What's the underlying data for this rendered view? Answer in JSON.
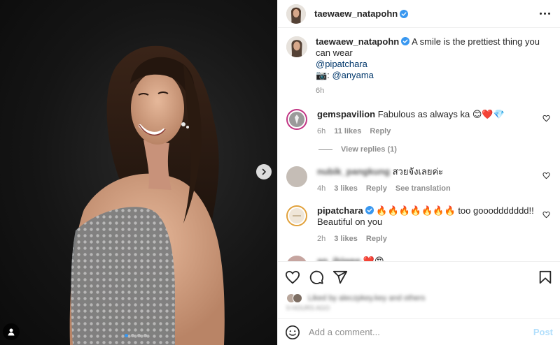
{
  "header": {
    "username": "taewaew_natapohn"
  },
  "caption": {
    "username": "taewaew_natapohn",
    "text": "A smile is the prettiest thing you can wear",
    "mention": "@pipatchara",
    "camera_glyph": "📷:",
    "camera_credit": "@anyama",
    "time": "6h"
  },
  "comments": [
    {
      "username": "gemspavilion",
      "text": "Fabulous as always ka",
      "emoji": "😊❤️💎",
      "time": "6h",
      "likes": "11 likes",
      "reply": "Reply",
      "view_replies": "View replies (1)"
    },
    {
      "username": "nubik_pangkung",
      "text": "สวยจังเลยค่ะ",
      "time": "4h",
      "likes": "3 likes",
      "reply": "Reply",
      "translate": "See translation"
    },
    {
      "username": "pipatchara",
      "fire": "🔥🔥🔥🔥🔥🔥🔥",
      "text": "too goooddddddd!! Beautiful on you",
      "time": "2h",
      "likes": "3 likes",
      "reply": "Reply"
    },
    {
      "username": "an_jhiwee",
      "emoji": "❤️😍"
    }
  ],
  "likes_line": {
    "text": "Liked by aleczpkey.key and others",
    "date": "9 HOURS AGO"
  },
  "composer": {
    "placeholder": "Add a comment...",
    "post_label": "Post"
  },
  "colors": {
    "verified": "#3897f0",
    "heart_red": "#ed4956",
    "link": "#00376b",
    "post_disabled": "#b2dffc"
  },
  "carousel": {
    "slide_count": 4,
    "active_index": 0
  },
  "icons": [
    "verified-icon",
    "more-options-icon",
    "heart-icon",
    "comment-icon",
    "share-icon",
    "save-icon",
    "emoji-icon",
    "next-arrow-icon",
    "user-tag-icon"
  ]
}
